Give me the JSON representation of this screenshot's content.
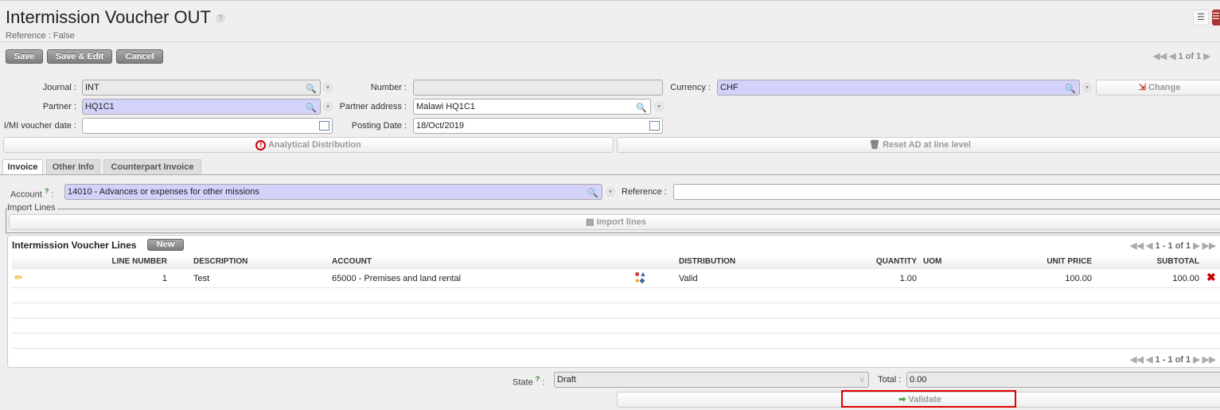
{
  "header": {
    "title": "Intermission Voucher OUT",
    "help": "?",
    "reference": "Reference : False"
  },
  "toolbar": {
    "save": "Save",
    "save_edit": "Save & Edit",
    "cancel": "Cancel",
    "pager": "1 of 1"
  },
  "form": {
    "journal_label": "Journal :",
    "journal": "INT",
    "number_label": "Number :",
    "number": "",
    "currency_label": "Currency :",
    "currency": "CHF",
    "change": "Change",
    "partner_label": "Partner :",
    "partner": "HQ1C1",
    "partner_address_label": "Partner address :",
    "partner_address": "Malawi HQ1C1",
    "voucher_date_label": "I/MI voucher date :",
    "voucher_date": "",
    "posting_date_label": "Posting Date :",
    "posting_date": "18/Oct/2019",
    "analytical": "Analytical Distribution",
    "reset_ad": "Reset AD at line level"
  },
  "tabs": [
    "Invoice",
    "Other Info",
    "Counterpart Invoice"
  ],
  "invoice": {
    "account_label": "Account",
    "account_help": "?",
    "account": "14010 - Advances or expenses for other missions",
    "reference_label": "Reference :",
    "reference": "",
    "import_legend": "Import Lines",
    "import_button": "Import lines"
  },
  "lines": {
    "title": "Intermission Voucher Lines",
    "new": "New",
    "pager": "1 - 1 of 1",
    "columns": [
      "LINE NUMBER",
      "DESCRIPTION",
      "ACCOUNT",
      "DISTRIBUTION",
      "QUANTITY",
      "UOM",
      "UNIT PRICE",
      "SUBTOTAL"
    ],
    "rows": [
      {
        "line": "1",
        "description": "Test",
        "account": "65000 - Premises and land rental",
        "distribution": "Valid",
        "quantity": "1.00",
        "uom": "",
        "unit_price": "100.00",
        "subtotal": "100.00"
      }
    ]
  },
  "footer": {
    "state_label": "State",
    "state_help": "?",
    "state": "Draft",
    "total_label": "Total :",
    "total": "0.00",
    "validate": "Validate"
  },
  "colors": {
    "required": "#d2d2fa",
    "highlight": "#e00000"
  }
}
